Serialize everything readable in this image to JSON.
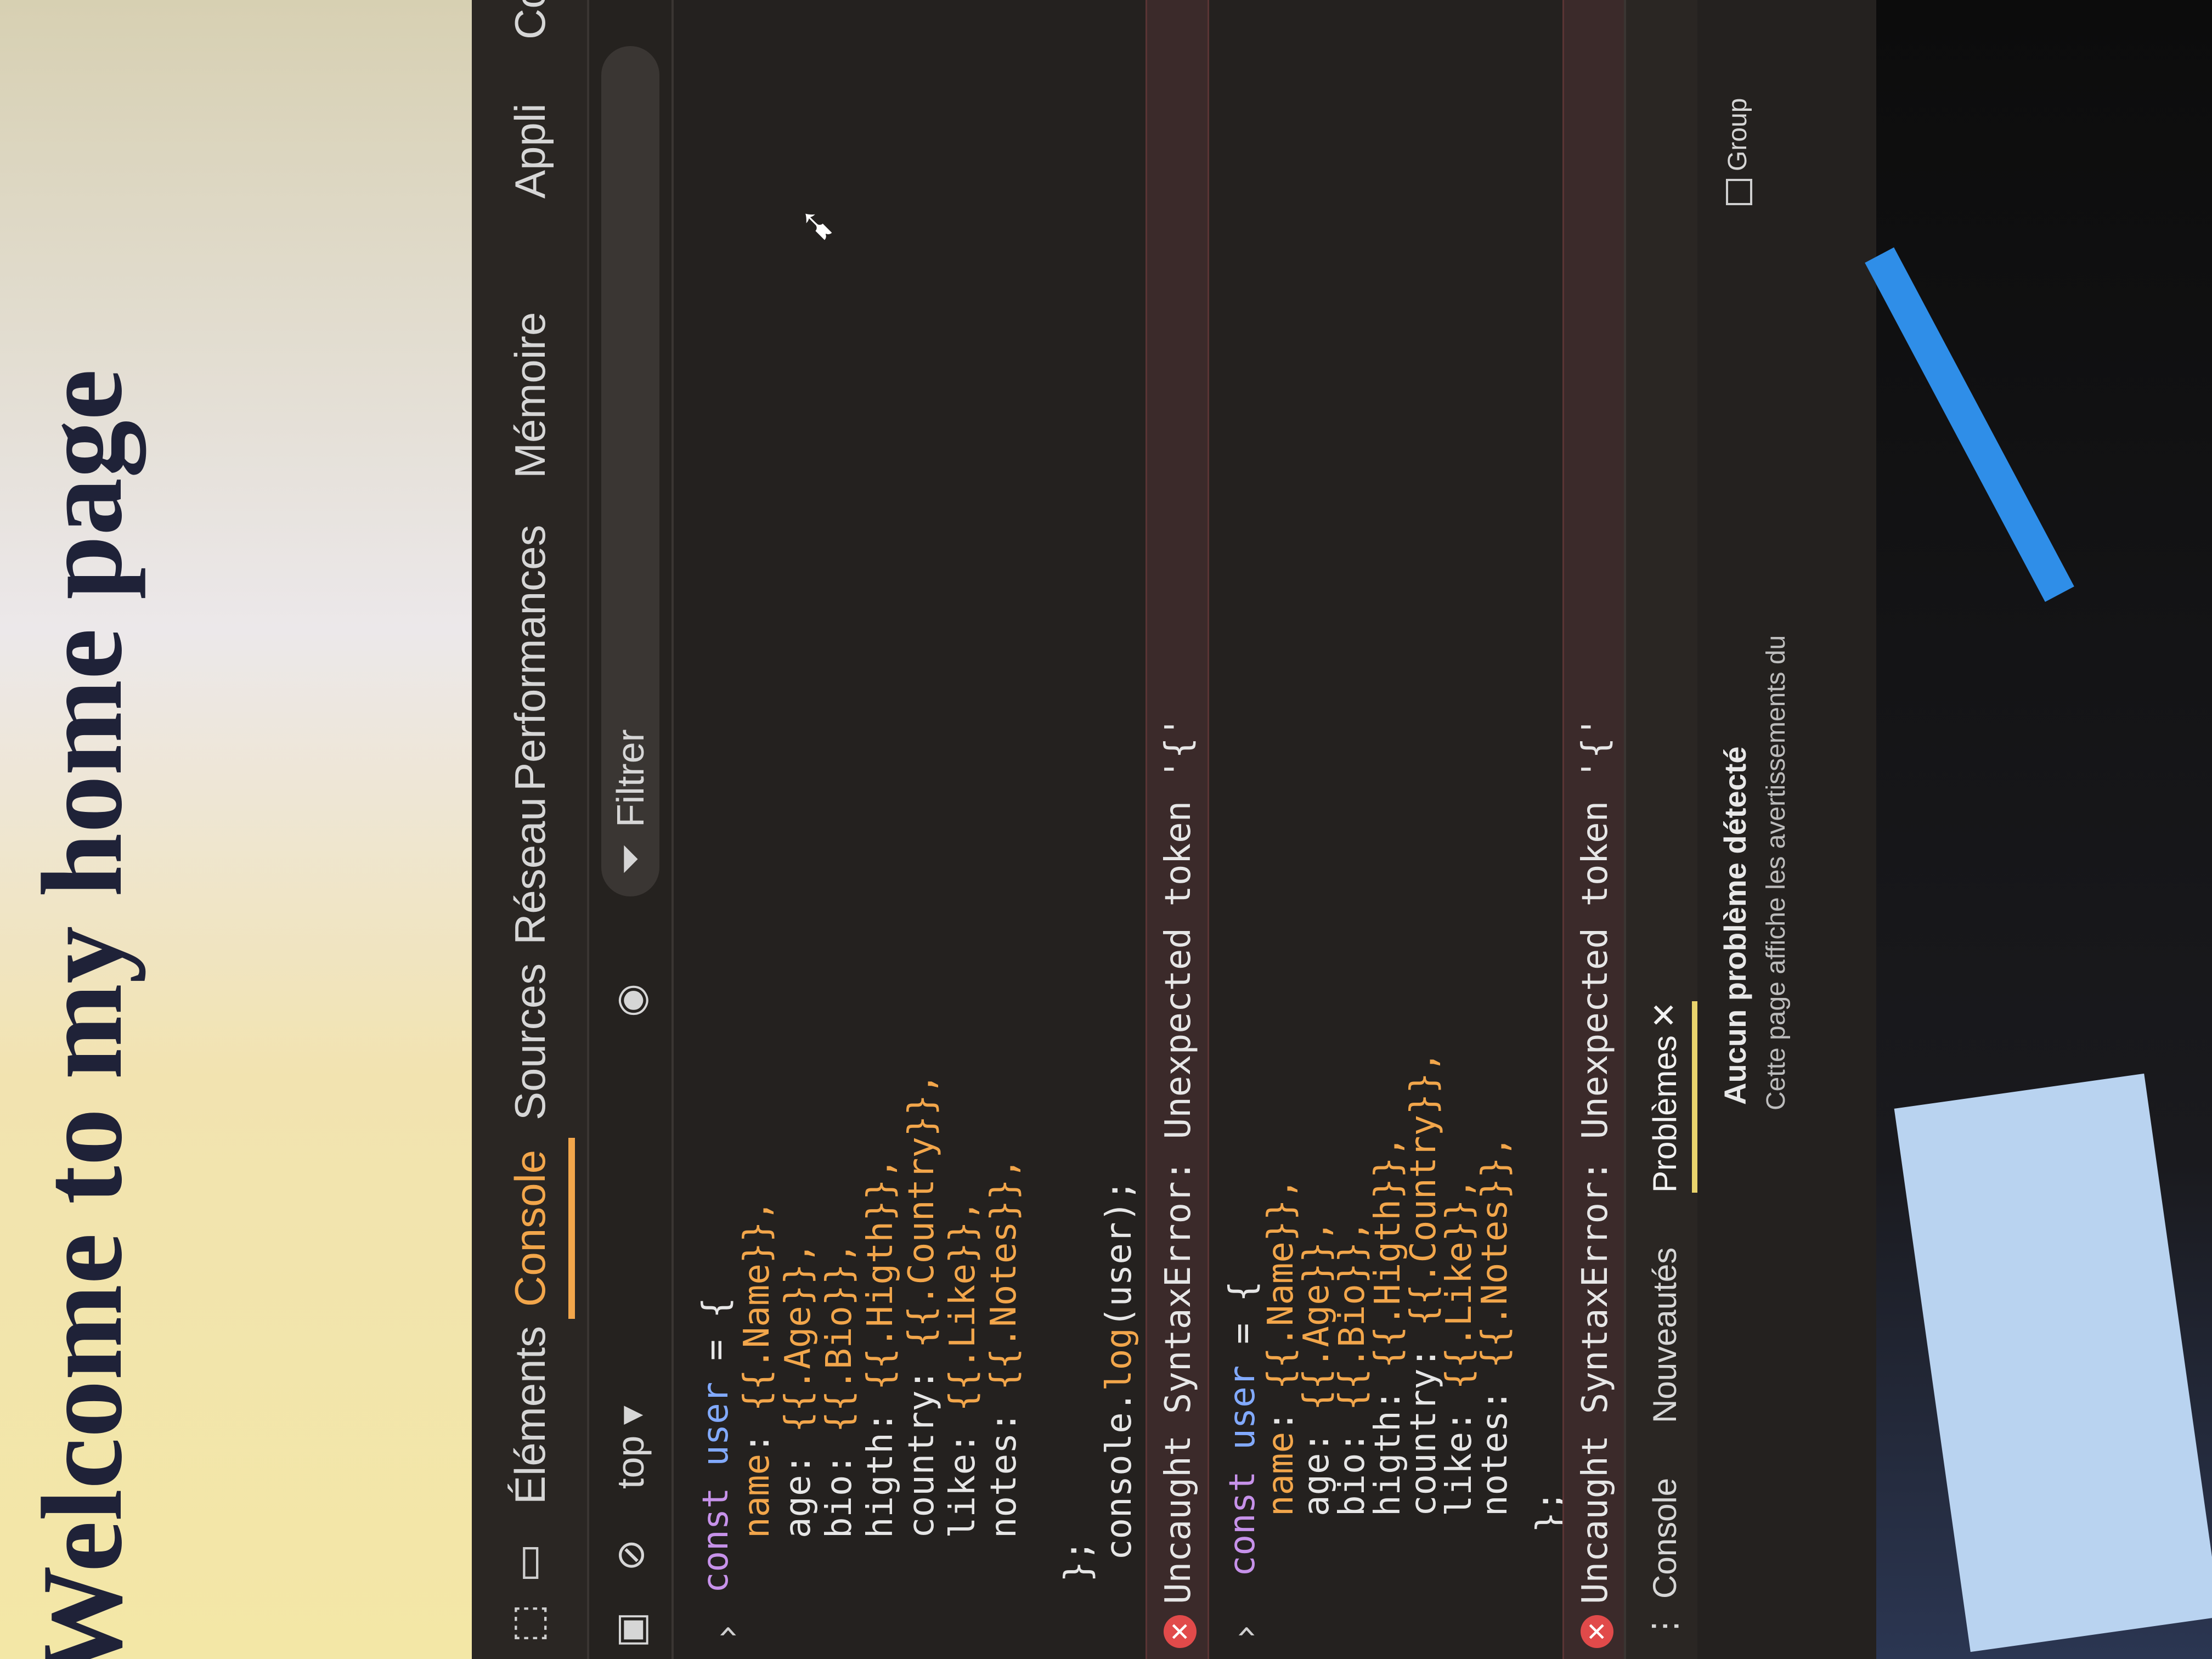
{
  "page": {
    "heading": "Welcome to my home page"
  },
  "devtools": {
    "tabs": [
      "Éléments",
      "Console",
      "Sources",
      "Réseau",
      "Performances",
      "Mémoire",
      "Appli",
      "Co"
    ],
    "toolbar": {
      "context": "top ▾",
      "filter": "Filtrer"
    },
    "console": {
      "block1": {
        "l1_kw": "const",
        "l1_var": "user",
        "l1_rest": " = {",
        "props": [
          {
            "key": "name",
            "val": "{{.Name}},"
          },
          {
            "key": "age",
            "val": "{{.Age}},"
          },
          {
            "key": "bio",
            "val": "{{.Bio}},"
          },
          {
            "key": "higth",
            "val": "{{.Higth}},"
          },
          {
            "key": "country",
            "val": "{{.Country}},"
          },
          {
            "key": "like",
            "val": "{{.Like}},"
          },
          {
            "key": "notes",
            "val": "{{.Notes}},"
          }
        ],
        "close": "};",
        "log_pre": "console.",
        "log_fn": "log",
        "log_post": "(user);"
      },
      "error1": "Uncaught SyntaxError: Unexpected token '{'",
      "block2": {
        "l1_kw": "const",
        "l1_var": "user",
        "l1_rest": " = {",
        "props": [
          {
            "key": "name",
            "val": "{{.Name}},"
          },
          {
            "key": "age",
            "val": "{{.Age}},"
          },
          {
            "key": "bio",
            "val": "{{.Bio}},"
          },
          {
            "key": "higth",
            "val": "{{.Higth}},"
          },
          {
            "key": "country",
            "val": "{{.Country}},"
          },
          {
            "key": "like",
            "val": "{{.Like}},"
          },
          {
            "key": "notes",
            "val": "{{.Notes}},"
          }
        ],
        "close": "};"
      },
      "error2": "Uncaught SyntaxError: Unexpected token '{'"
    },
    "drawer_tabs": [
      "Console",
      "Nouveautés",
      "Problèmes"
    ],
    "issues": {
      "title": "Aucun problème détecté",
      "subtitle": "Cette page affiche les avertissements du",
      "group": "Group"
    }
  },
  "icons": [
    "inspect-icon",
    "device-icon",
    "sidebar-icon",
    "clear-icon",
    "eye-icon",
    "filter-icon",
    "error-icon",
    "chevron-icon",
    "more-icon",
    "close-icon",
    "cursor-icon"
  ],
  "colors": {
    "accent": "#f2a64b",
    "error": "#e14a4a",
    "keyword": "#c792ea",
    "variable": "#82aaff"
  }
}
